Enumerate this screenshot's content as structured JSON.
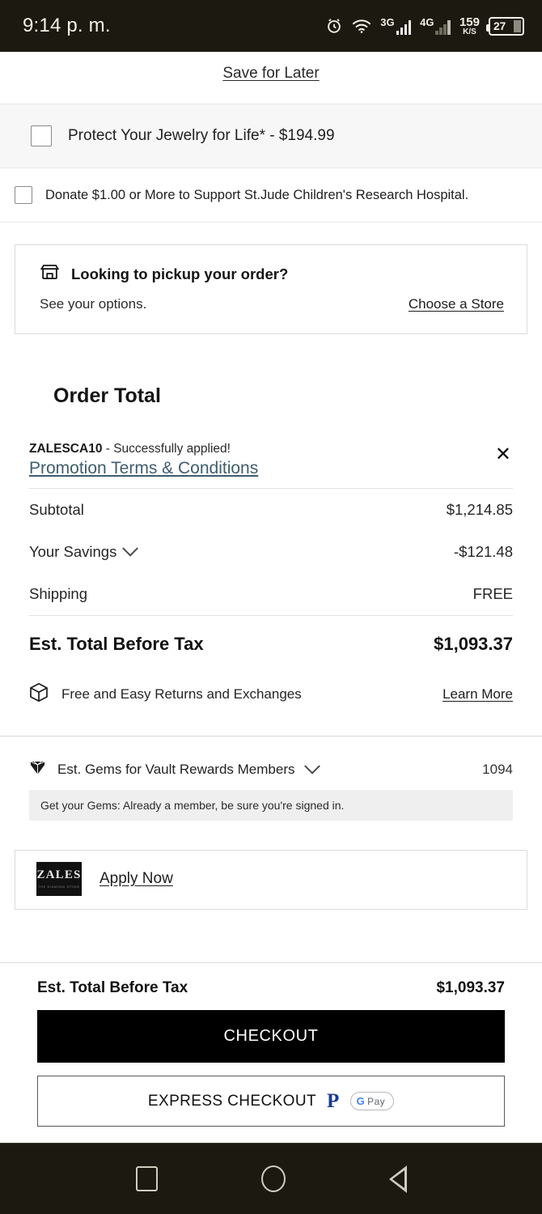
{
  "status_bar": {
    "time": "9:14 p. m.",
    "alarm_icon": "alarm-clock-icon",
    "wifi_icon": "wifi-icon",
    "sim1_label": "3G",
    "sim2_label": "4G",
    "network_speed": "159",
    "network_speed_unit": "K/S",
    "battery_percent": "27"
  },
  "cart": {
    "save_for_later": "Save for Later",
    "insurance_label": "Protect Your Jewelry for Life* - $194.99",
    "donate_label": "Donate $1.00 or More to Support St.Jude Children's Research Hospital."
  },
  "pickup": {
    "icon": "storefront-icon",
    "title": "Looking to pickup your order?",
    "subtitle": "See your options.",
    "cta": "Choose a Store"
  },
  "order_total": {
    "heading": "Order Total",
    "promo": {
      "code": "ZALESCA10",
      "status": " - Successfully applied!",
      "terms_link": "Promotion Terms & Conditions",
      "close_icon": "close-icon",
      "link_color": "#3f5d6e"
    },
    "rows": [
      {
        "label": "Subtotal",
        "value": "$1,214.85",
        "expandable": false
      },
      {
        "label": "Your Savings",
        "value": "-$121.48",
        "expandable": true
      },
      {
        "label": "Shipping",
        "value": "FREE",
        "expandable": false
      }
    ],
    "grand_label": "Est. Total Before Tax",
    "grand_value": "$1,093.37"
  },
  "returns": {
    "icon": "package-box-icon",
    "text": "Free and Easy Returns and Exchanges",
    "link": "Learn More"
  },
  "gems": {
    "icon": "gem-icon",
    "label": "Est. Gems for Vault Rewards Members",
    "value": "1094",
    "hint": "Get your Gems: Already a member, be sure you're signed in."
  },
  "credit_card": {
    "logo_text": "ZALES",
    "logo_subtext": "THE DIAMOND STORE",
    "apply_link": "Apply Now"
  },
  "footer": {
    "total_label": "Est. Total Before Tax",
    "total_value": "$1,093.37",
    "checkout_label": "CHECKOUT",
    "express_label": "EXPRESS CHECKOUT",
    "paypal_icon": "paypal-icon",
    "gpay_g": "G",
    "gpay_pay": "Pay"
  },
  "navbar": {
    "recents_icon": "square-recents-icon",
    "home_icon": "circle-home-icon",
    "back_icon": "triangle-back-icon"
  }
}
